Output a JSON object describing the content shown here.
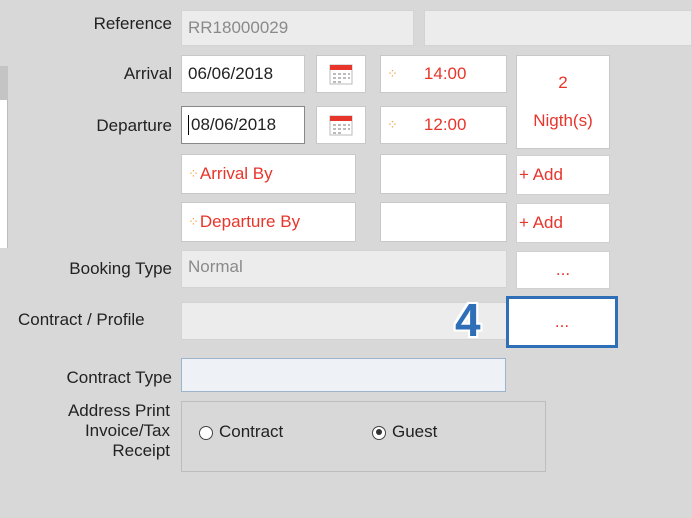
{
  "reference": {
    "label": "Reference",
    "value": "RR18000029"
  },
  "arrival": {
    "label": "Arrival",
    "date": "06/06/2018",
    "time": "14:00"
  },
  "departure": {
    "label": "Departure",
    "date": "08/06/2018",
    "time": "12:00"
  },
  "nights": {
    "count": "2",
    "unit": "Nigth(s)"
  },
  "arrival_by": {
    "placeholder": "Arrival By",
    "add_label": "+ Add"
  },
  "departure_by": {
    "placeholder": "Departure By",
    "add_label": "+ Add"
  },
  "booking_type": {
    "label": "Booking Type",
    "value": "Normal",
    "button": "..."
  },
  "contract_profile": {
    "label": "Contract / Profile",
    "button": "...",
    "callout": "4"
  },
  "contract_type": {
    "label": "Contract Type",
    "value": ""
  },
  "address_print": {
    "label_line1": "Address Print",
    "label_line2": "Invoice/Tax",
    "label_line3": "Receipt",
    "options": [
      "Contract",
      "Guest"
    ],
    "selected": "Guest"
  },
  "colors": {
    "accent_red": "#e8352b",
    "callout_blue": "#2f6fb8",
    "icon_orange": "#f2a33a"
  }
}
